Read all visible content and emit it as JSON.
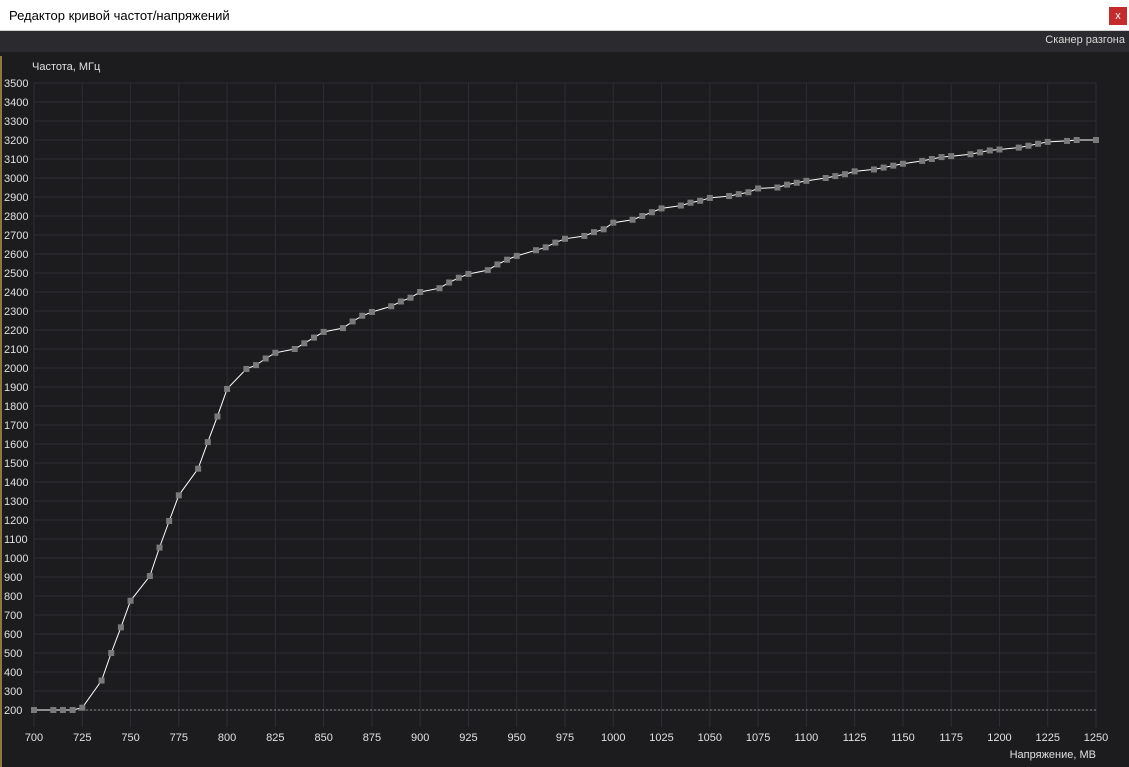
{
  "window": {
    "title": "Редактор кривой частот/напряжений",
    "close_label": "x"
  },
  "toolbar": {
    "scanner_label": "Сканер разгона"
  },
  "colors": {
    "background": "#1c1c1f",
    "grid": "#2e2e33",
    "curve": "#ffffff",
    "point": "#7a7a7a",
    "baseline": "#8a8a8a"
  },
  "chart_data": {
    "type": "line",
    "ylabel": "Частота, МГц",
    "xlabel": "Напряжение, МВ",
    "xlim": [
      700,
      1250
    ],
    "ylim": [
      100,
      3500
    ],
    "x_ticks": [
      700,
      725,
      750,
      775,
      800,
      825,
      850,
      875,
      900,
      925,
      950,
      975,
      1000,
      1025,
      1050,
      1075,
      1100,
      1125,
      1150,
      1175,
      1200,
      1225,
      1250
    ],
    "y_ticks": [
      200,
      300,
      400,
      500,
      600,
      700,
      800,
      900,
      1000,
      1100,
      1200,
      1300,
      1400,
      1500,
      1600,
      1700,
      1800,
      1900,
      2000,
      2100,
      2200,
      2300,
      2400,
      2500,
      2600,
      2700,
      2800,
      2900,
      3000,
      3100,
      3200,
      3300,
      3400,
      3500
    ],
    "grid": true,
    "baseline": 200,
    "points": [
      [
        700,
        200
      ],
      [
        710,
        200
      ],
      [
        715,
        200
      ],
      [
        720,
        200
      ],
      [
        725,
        212
      ],
      [
        735,
        355
      ],
      [
        740,
        500
      ],
      [
        745,
        635
      ],
      [
        750,
        775
      ],
      [
        760,
        905
      ],
      [
        765,
        1055
      ],
      [
        770,
        1195
      ],
      [
        775,
        1330
      ],
      [
        785,
        1470
      ],
      [
        790,
        1610
      ],
      [
        795,
        1745
      ],
      [
        800,
        1890
      ],
      [
        810,
        1995
      ],
      [
        815,
        2015
      ],
      [
        820,
        2050
      ],
      [
        825,
        2080
      ],
      [
        835,
        2100
      ],
      [
        840,
        2130
      ],
      [
        845,
        2160
      ],
      [
        850,
        2190
      ],
      [
        860,
        2210
      ],
      [
        865,
        2245
      ],
      [
        870,
        2275
      ],
      [
        875,
        2295
      ],
      [
        885,
        2325
      ],
      [
        890,
        2350
      ],
      [
        895,
        2370
      ],
      [
        900,
        2400
      ],
      [
        910,
        2420
      ],
      [
        915,
        2450
      ],
      [
        920,
        2475
      ],
      [
        925,
        2495
      ],
      [
        935,
        2515
      ],
      [
        940,
        2545
      ],
      [
        945,
        2570
      ],
      [
        950,
        2590
      ],
      [
        960,
        2620
      ],
      [
        965,
        2635
      ],
      [
        970,
        2660
      ],
      [
        975,
        2680
      ],
      [
        985,
        2695
      ],
      [
        990,
        2715
      ],
      [
        995,
        2730
      ],
      [
        1000,
        2765
      ],
      [
        1010,
        2780
      ],
      [
        1015,
        2800
      ],
      [
        1020,
        2820
      ],
      [
        1025,
        2840
      ],
      [
        1035,
        2855
      ],
      [
        1040,
        2870
      ],
      [
        1045,
        2880
      ],
      [
        1050,
        2895
      ],
      [
        1060,
        2905
      ],
      [
        1065,
        2915
      ],
      [
        1070,
        2925
      ],
      [
        1075,
        2945
      ],
      [
        1085,
        2950
      ],
      [
        1090,
        2965
      ],
      [
        1095,
        2975
      ],
      [
        1100,
        2985
      ],
      [
        1110,
        3000
      ],
      [
        1115,
        3010
      ],
      [
        1120,
        3020
      ],
      [
        1125,
        3035
      ],
      [
        1135,
        3045
      ],
      [
        1140,
        3055
      ],
      [
        1145,
        3065
      ],
      [
        1150,
        3075
      ],
      [
        1160,
        3090
      ],
      [
        1165,
        3100
      ],
      [
        1170,
        3110
      ],
      [
        1175,
        3115
      ],
      [
        1185,
        3125
      ],
      [
        1190,
        3135
      ],
      [
        1195,
        3145
      ],
      [
        1200,
        3150
      ],
      [
        1210,
        3160
      ],
      [
        1215,
        3170
      ],
      [
        1220,
        3180
      ],
      [
        1225,
        3190
      ],
      [
        1235,
        3195
      ],
      [
        1240,
        3200
      ],
      [
        1250,
        3200
      ]
    ]
  }
}
